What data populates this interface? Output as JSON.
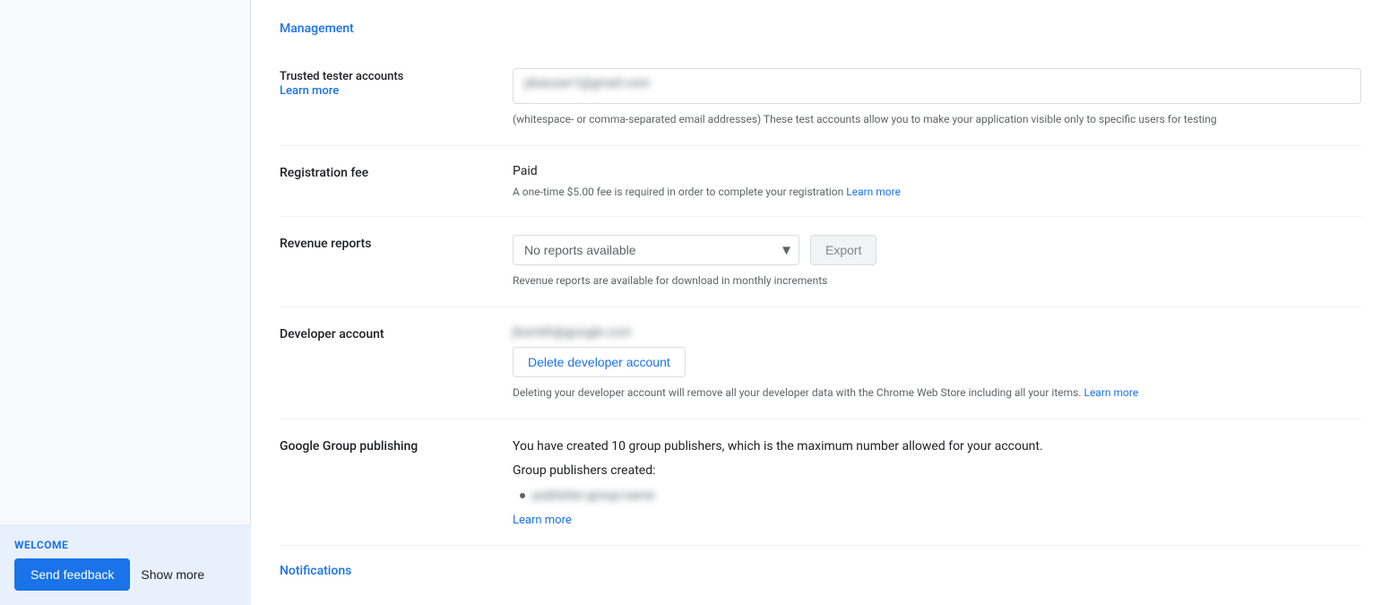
{
  "sidebar": {
    "welcome_label": "WELCOME",
    "send_feedback_label": "Send feedback",
    "show_more_label": "Show more"
  },
  "management": {
    "section_title": "Management",
    "trusted_tester": {
      "label": "Trusted tester accounts",
      "learn_more": "Learn more",
      "email_placeholder": "jdoeuser1@gmail.com",
      "helper_text": "(whitespace- or comma-separated email addresses) These test accounts allow you to make your application visible only to specific users for testing"
    },
    "registration_fee": {
      "label": "Registration fee",
      "status": "Paid",
      "fee_info": "A one-time $5.00 fee is required in order to complete your registration",
      "learn_more": "Learn more"
    },
    "revenue_reports": {
      "label": "Revenue reports",
      "dropdown_option": "No reports available",
      "export_label": "Export",
      "helper_text": "Revenue reports are available for download in monthly increments"
    },
    "developer_account": {
      "label": "Developer account",
      "account_email": "jhsmith@google.com",
      "delete_btn_label": "Delete developer account",
      "warning_text": "Deleting your developer account will remove all your developer data with the Chrome Web Store including all your items.",
      "learn_more": "Learn more"
    },
    "google_group_publishing": {
      "label": "Google Group publishing",
      "description": "You have created 10 group publishers, which is the maximum number allowed for your account.",
      "publishers_created_label": "Group publishers created:",
      "publisher_item": "publisher-group-name",
      "learn_more": "Learn more"
    }
  },
  "notifications": {
    "section_title": "Notifications"
  }
}
